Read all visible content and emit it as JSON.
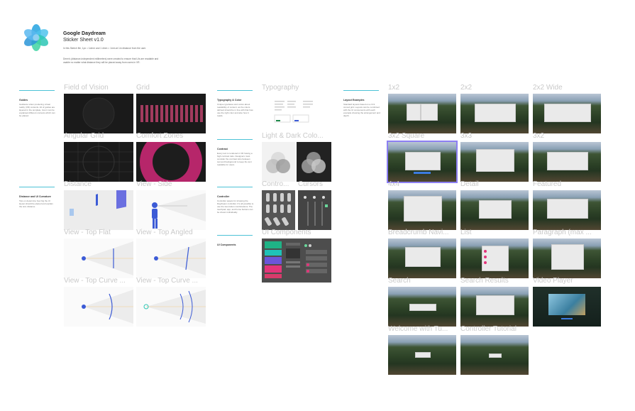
{
  "header": {
    "title": "Google Daydream",
    "subtitle": "Sticker Sheet v1.0",
    "intro_1": "In this Sketch file, 1px = 1dmm and 1 dmm = 1mm at 1m distance from the user.",
    "intro_2": "Dmm's (distance-independent millimeters) were created to ensure that UIs are readable and usable no matter what distance they will be placed away from users in VR."
  },
  "sections": {
    "guides": {
      "heading": "Guides",
      "body": "Guidance when producing virtual reality (VR) contents. All of guides are layered in the template, how it can be explained different contexts which can be placed."
    },
    "distance": {
      "heading": "Distance and UI Curvature",
      "body": "Tips on determine how big the UI layout should be placed and explain the size distance."
    },
    "typography": {
      "heading": "Typography & Color",
      "body": "Unique typefaces and colors about readability of content, as the colors defined should be in line with that how use the right color and also how it reads."
    },
    "contrast": {
      "heading": "Contrast",
      "body": "Every text is rendered in VR having a high contrast ratio. Designers must consider the contrast ratio between text and background to keep the text readable for users."
    },
    "controller": {
      "heading": "Controller",
      "body": "Controller assets for showing the Daydream controller. It's all possible to use the two-button combinations. The touchpad, app, and home buttons can be shown individually."
    },
    "ui_components": {
      "heading": "UI Components"
    },
    "layout": {
      "heading": "Layout Examples",
      "body": "Standard layouts based on a 3×3 curved grid. Layouts can be combined with the UI components with each example showing the arrangement and depth."
    }
  },
  "thumbnails": {
    "fov": "Field of Vision",
    "grid": "Grid",
    "angular": "Angular Grid",
    "comfort": "Comfort Zones",
    "distance": "Distance",
    "view_side": "View - Side",
    "top_flat": "View - Top Flat",
    "top_angled": "View - Top Angled",
    "top_curve_1": "View - Top Curve ...",
    "top_curve_2": "View - Top Curve ...",
    "typography": "Typography",
    "lightdark": "Light & Dark Colo...",
    "controllers": "Contro...",
    "cursors": "Cursors",
    "ui_components": "UI Components"
  },
  "layouts": [
    "1x2",
    "2x2",
    "2x2 Wide",
    "3x2 Square",
    "3x3",
    "3x2",
    "4x4",
    "Detail",
    "Featured",
    "Breadcrumb Navi...",
    "List",
    "Paragraph (max ...",
    "Search",
    "Search Results",
    "Video Player",
    "Welcome with Tu...",
    "Controller Tutorial"
  ],
  "colors": {
    "accent_rule": "#4cc2d6",
    "selected": "#8c7ff2",
    "comfort_ring": "#b6266a",
    "grid_bars": "#a23b5e",
    "view_blue": "#3c5bd6"
  },
  "icons": [
    "daydream-logo-icon",
    "person-icon",
    "controller-icon",
    "cursor-icon"
  ]
}
